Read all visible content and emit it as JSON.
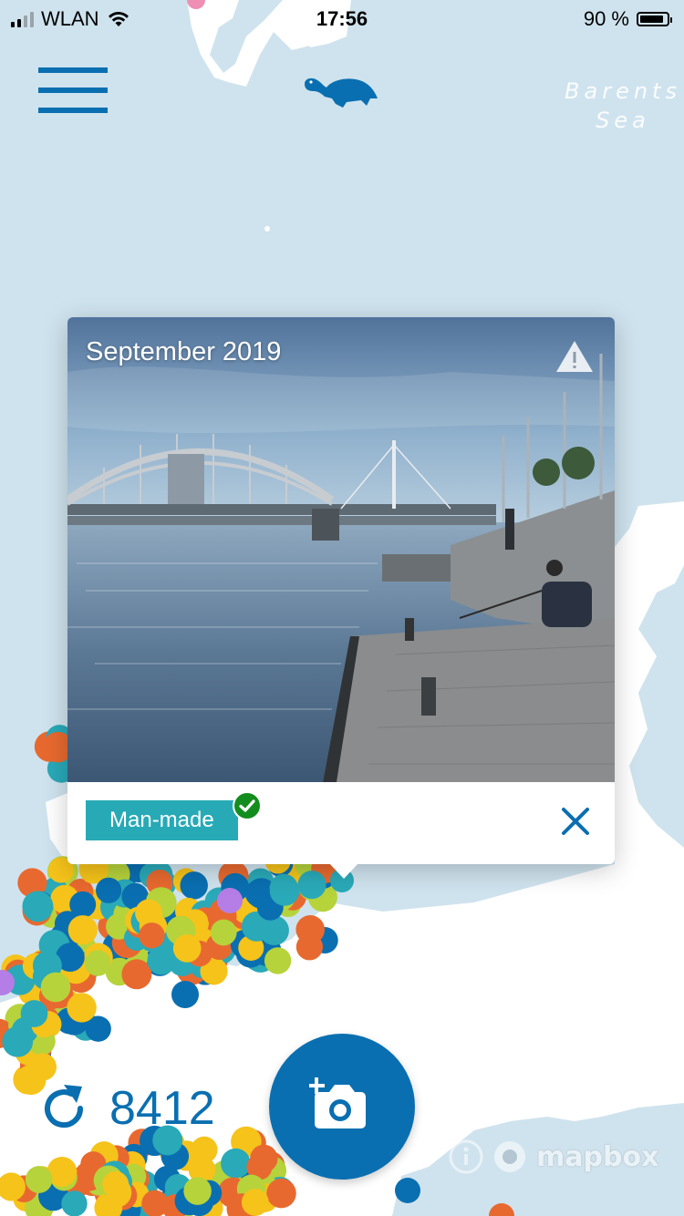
{
  "status_bar": {
    "carrier": "WLAN",
    "time": "17:56",
    "battery": "90 %",
    "battery_level": 0.9
  },
  "map": {
    "sea_label_line1": "Barents",
    "sea_label_line2": "Sea",
    "attribution": "mapbox"
  },
  "popup": {
    "date": "September 2019",
    "tag": "Man-made"
  },
  "footer": {
    "count": "8412"
  },
  "colors": {
    "accent": "#0a6fb1",
    "tag": "#27aab6",
    "land": "#ffffff",
    "water": "#cfe3ee",
    "dot_colors": [
      "#f5c31a",
      "#0a6fb1",
      "#2aa9b8",
      "#e8692f",
      "#b6d33b",
      "#b57de6",
      "#ef8fb4"
    ]
  },
  "icons": {
    "menu": "hamburger-icon",
    "logo": "turtle-icon",
    "report": "warning-icon",
    "verified": "check-circle-icon",
    "close": "close-icon",
    "refresh": "refresh-icon",
    "camera": "add-photo-icon",
    "info": "info-icon"
  }
}
